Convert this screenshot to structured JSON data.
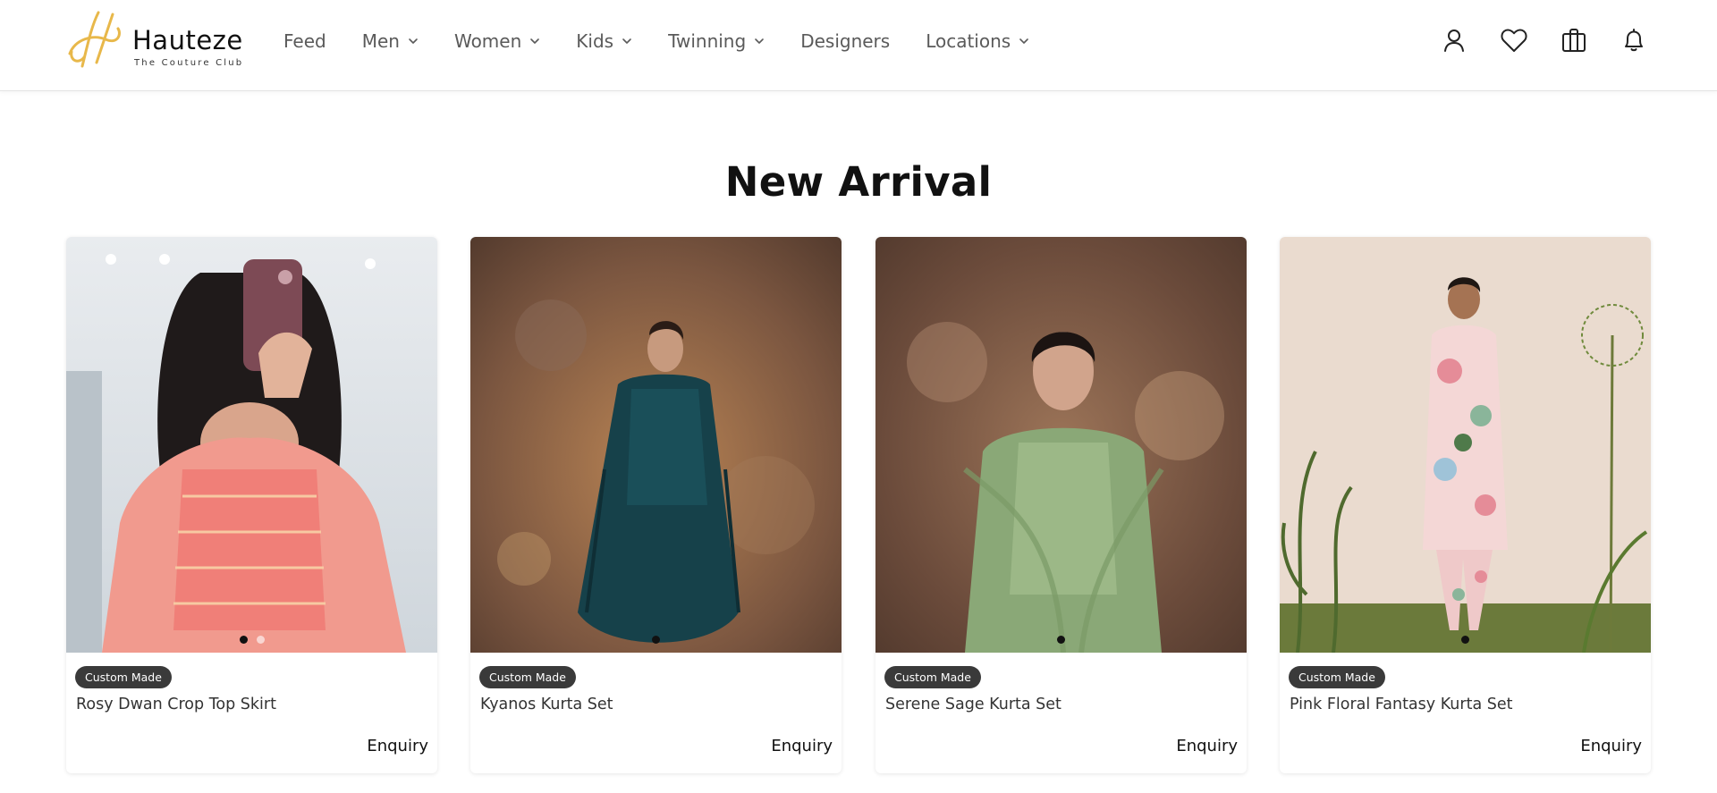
{
  "brand": {
    "name": "Hauteze",
    "tagline": "The Couture Club",
    "accent_color": "#e8b84a"
  },
  "nav": {
    "items": [
      {
        "label": "Feed",
        "has_dropdown": false
      },
      {
        "label": "Men",
        "has_dropdown": true
      },
      {
        "label": "Women",
        "has_dropdown": true
      },
      {
        "label": "Kids",
        "has_dropdown": true
      },
      {
        "label": "Twinning",
        "has_dropdown": true
      },
      {
        "label": "Designers",
        "has_dropdown": false
      },
      {
        "label": "Locations",
        "has_dropdown": true
      }
    ]
  },
  "header_icons": [
    "user-icon",
    "heart-icon",
    "shopping-bag-icon",
    "bell-icon"
  ],
  "section": {
    "title": "New Arrival"
  },
  "products": [
    {
      "badge": "Custom Made",
      "name": "Rosy Dwan Crop Top Skirt",
      "action": "Enquiry",
      "image_slides": 2,
      "active_slide": 1
    },
    {
      "badge": "Custom Made",
      "name": "Kyanos Kurta Set",
      "action": "Enquiry",
      "image_slides": 1,
      "active_slide": 1
    },
    {
      "badge": "Custom Made",
      "name": "Serene Sage Kurta Set",
      "action": "Enquiry",
      "image_slides": 1,
      "active_slide": 1
    },
    {
      "badge": "Custom Made",
      "name": "Pink Floral Fantasy Kurta Set",
      "action": "Enquiry",
      "image_slides": 1,
      "active_slide": 1
    }
  ],
  "colors": {
    "badge_bg": "#3a3a3a",
    "nav_text": "#5a5a5a",
    "title_text": "#111111"
  }
}
